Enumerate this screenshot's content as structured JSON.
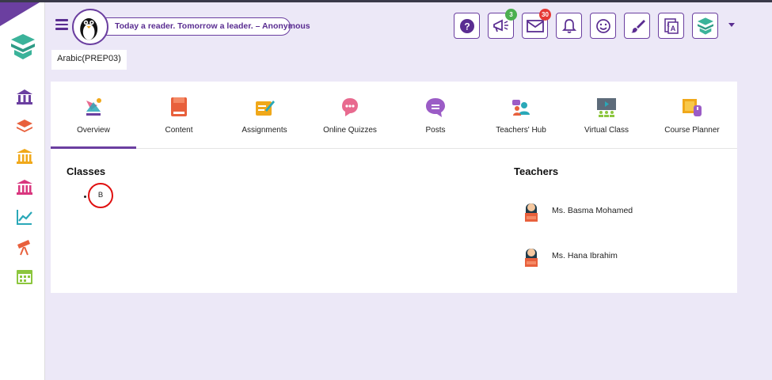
{
  "header": {
    "quote": "Today a reader. Tomorrow a leader. – Anonymous",
    "notifications_badge": "3",
    "messages_badge": "30"
  },
  "toolbar": {
    "buttons": [
      "help-icon",
      "megaphone-icon",
      "mail-icon",
      "bell-icon",
      "smiley-icon",
      "paintbrush-icon",
      "translate-icon",
      "app-logo-icon"
    ]
  },
  "course": {
    "name": "Arabic(PREP03)"
  },
  "tabs": [
    {
      "label": "Overview",
      "icon": "overview-icon"
    },
    {
      "label": "Content",
      "icon": "book-icon"
    },
    {
      "label": "Assignments",
      "icon": "assignment-icon"
    },
    {
      "label": "Online Quizzes",
      "icon": "quiz-icon"
    },
    {
      "label": "Posts",
      "icon": "chat-bubble-icon"
    },
    {
      "label": "Teachers' Hub",
      "icon": "teachers-hub-icon"
    },
    {
      "label": "Virtual Class",
      "icon": "virtual-class-icon"
    },
    {
      "label": "Course Planner",
      "icon": "planner-icon"
    }
  ],
  "classes": {
    "title": "Classes",
    "items": [
      "B"
    ]
  },
  "teachers": {
    "title": "Teachers",
    "items": [
      "Ms. Basma Mohamed",
      "Ms. Hana Ibrahim"
    ]
  },
  "colors": {
    "brand": "#6b3fa0",
    "background": "#ece8f7",
    "teal": "#3bb39a",
    "highlight_ring": "#e01010"
  }
}
